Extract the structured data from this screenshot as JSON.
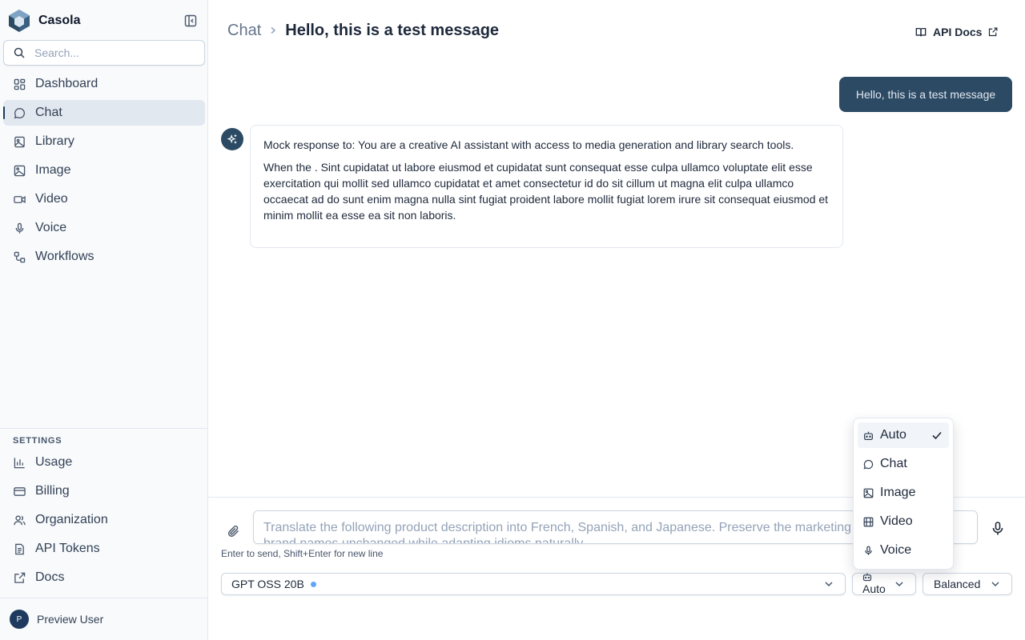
{
  "app": {
    "name": "Casola"
  },
  "sidebar": {
    "search_placeholder": "Search...",
    "nav": [
      {
        "label": "Dashboard",
        "icon": "dashboard-icon",
        "active": false
      },
      {
        "label": "Chat",
        "icon": "chat-icon",
        "active": true
      },
      {
        "label": "Library",
        "icon": "library-icon",
        "active": false
      },
      {
        "label": "Image",
        "icon": "image-icon",
        "active": false
      },
      {
        "label": "Video",
        "icon": "video-icon",
        "active": false
      },
      {
        "label": "Voice",
        "icon": "mic-icon",
        "active": false
      },
      {
        "label": "Workflows",
        "icon": "workflow-icon",
        "active": false
      }
    ],
    "settings_heading": "SETTINGS",
    "settings": [
      {
        "label": "Usage",
        "icon": "bar-chart-icon"
      },
      {
        "label": "Billing",
        "icon": "credit-card-icon"
      },
      {
        "label": "Organization",
        "icon": "users-icon"
      },
      {
        "label": "API Tokens",
        "icon": "document-icon"
      },
      {
        "label": "Docs",
        "icon": "external-link-icon"
      }
    ],
    "user": {
      "initial": "P",
      "name": "Preview User"
    }
  },
  "header": {
    "breadcrumb_root": "Chat",
    "title": "Hello, this is a test message",
    "api_docs_label": "API Docs"
  },
  "messages": {
    "user": "Hello, this is a test message",
    "assistant": {
      "para1": "Mock response to: You are a creative AI assistant with access to media generation and library search tools.",
      "para2": "When the . Sint cupidatat ut labore eiusmod et cupidatat sunt consequat esse culpa ullamco voluptate elit esse exercitation qui mollit sed ullamco cupidatat et amet consectetur id do sit cillum ut magna elit culpa ullamco occaecat ad do sunt enim magna nulla sint fugiat proident labore mollit fugiat lorem irure sit consequat eiusmod et minim mollit ea esse ea sit non laboris."
    }
  },
  "composer": {
    "placeholder": "Translate the following product description into French, Spanish, and Japanese. Preserve the marketing tone and keep brand names unchanged while adapting idioms naturally.",
    "hint": "Enter to send, Shift+Enter for new line",
    "model": "GPT OSS 20B",
    "mode": "Auto",
    "preset": "Balanced"
  },
  "mode_menu": {
    "items": [
      {
        "label": "Auto",
        "icon": "robot-icon",
        "selected": true
      },
      {
        "label": "Chat",
        "icon": "chat-icon",
        "selected": false
      },
      {
        "label": "Image",
        "icon": "image-icon",
        "selected": false
      },
      {
        "label": "Video",
        "icon": "film-icon",
        "selected": false
      },
      {
        "label": "Voice",
        "icon": "mic-icon",
        "selected": false
      }
    ]
  },
  "colors": {
    "accent": "#2c4a64",
    "sidebar_bg": "#f8fafc",
    "active_bg": "#e2e8f0",
    "status_dot": "#60a5fa"
  }
}
